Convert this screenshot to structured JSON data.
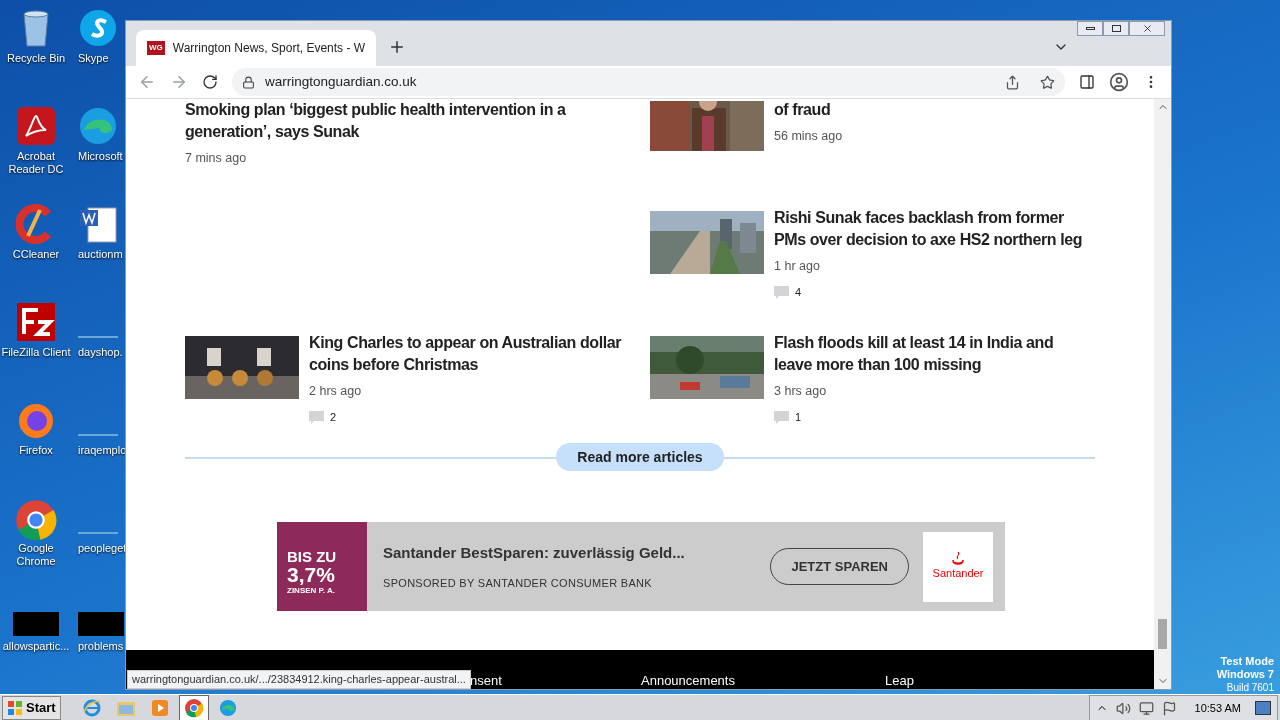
{
  "desktop_icons": [
    {
      "label": "Recycle Bin",
      "kind": "bin"
    },
    {
      "label": "Skype",
      "kind": "skype"
    },
    {
      "label": "Acrobat Reader DC",
      "kind": "acrobat"
    },
    {
      "label": "Microsoft",
      "kind": "edge"
    },
    {
      "label": "CCleaner",
      "kind": "ccleaner"
    },
    {
      "label": "auctionm",
      "kind": "word"
    },
    {
      "label": "FileZilla Client",
      "kind": "filezilla"
    },
    {
      "label": "dayshop.",
      "kind": "blank"
    },
    {
      "label": "Firefox",
      "kind": "firefox"
    },
    {
      "label": "iraqemplo",
      "kind": "blank"
    },
    {
      "label": "Google Chrome",
      "kind": "chrome"
    },
    {
      "label": "peopleget",
      "kind": "blank"
    },
    {
      "label": "allowspartic...",
      "kind": "black"
    },
    {
      "label": "problems",
      "kind": "black"
    }
  ],
  "browser": {
    "tabs": [
      {
        "favicon": "WG",
        "title": "Warrington News, Sport, Events - W",
        "selected": true
      }
    ],
    "url": "warringtonguardian.co.uk",
    "article_rows": [
      {
        "left": {
          "headline": "Smoking plan ‘biggest public health intervention in a generation’, says Sunak",
          "time": "7 mins ago"
        },
        "right": {
          "headline": "of fraud",
          "time": "56 mins ago"
        }
      },
      {
        "right": {
          "headline": "Rishi Sunak faces backlash from former PMs over decision to axe HS2 northern leg",
          "time": "1 hr ago",
          "comments": "4"
        }
      },
      {
        "left": {
          "headline": "King Charles to appear on Australian dollar coins before Christmas",
          "time": "2 hrs ago",
          "comments": "2"
        },
        "right": {
          "headline": "Flash floods kill at least 14 in India and leave more than 100 missing",
          "time": "3 hrs ago",
          "comments": "1"
        }
      }
    ],
    "read_more": "Read more articles",
    "ad": {
      "image_lines": [
        "BIS ZU",
        "3,7%",
        "ZINSEN P. A."
      ],
      "title": "Santander BestSparen: zuverlässig Geld...",
      "sponsor": "SPONSORED BY SANTANDER CONSUMER BANK",
      "button": "JETZT SPAREN",
      "logo": "Santander"
    },
    "footer_links": [
      "nsent",
      "Announcements",
      "Leap"
    ],
    "status_url": "warringtonguardian.co.uk/.../23834912.king-charles-appear-austral..."
  },
  "watermark_lines": [
    "Test Mode",
    "Windows 7",
    "Build 7601"
  ],
  "taskbar": {
    "start": "Start",
    "apps": [
      {
        "kind": "ie",
        "selected": false
      },
      {
        "kind": "explorer",
        "selected": false
      },
      {
        "kind": "media",
        "selected": false
      },
      {
        "kind": "chrome",
        "selected": true
      },
      {
        "kind": "edge",
        "selected": false
      }
    ],
    "clock": "10:53 AM"
  }
}
